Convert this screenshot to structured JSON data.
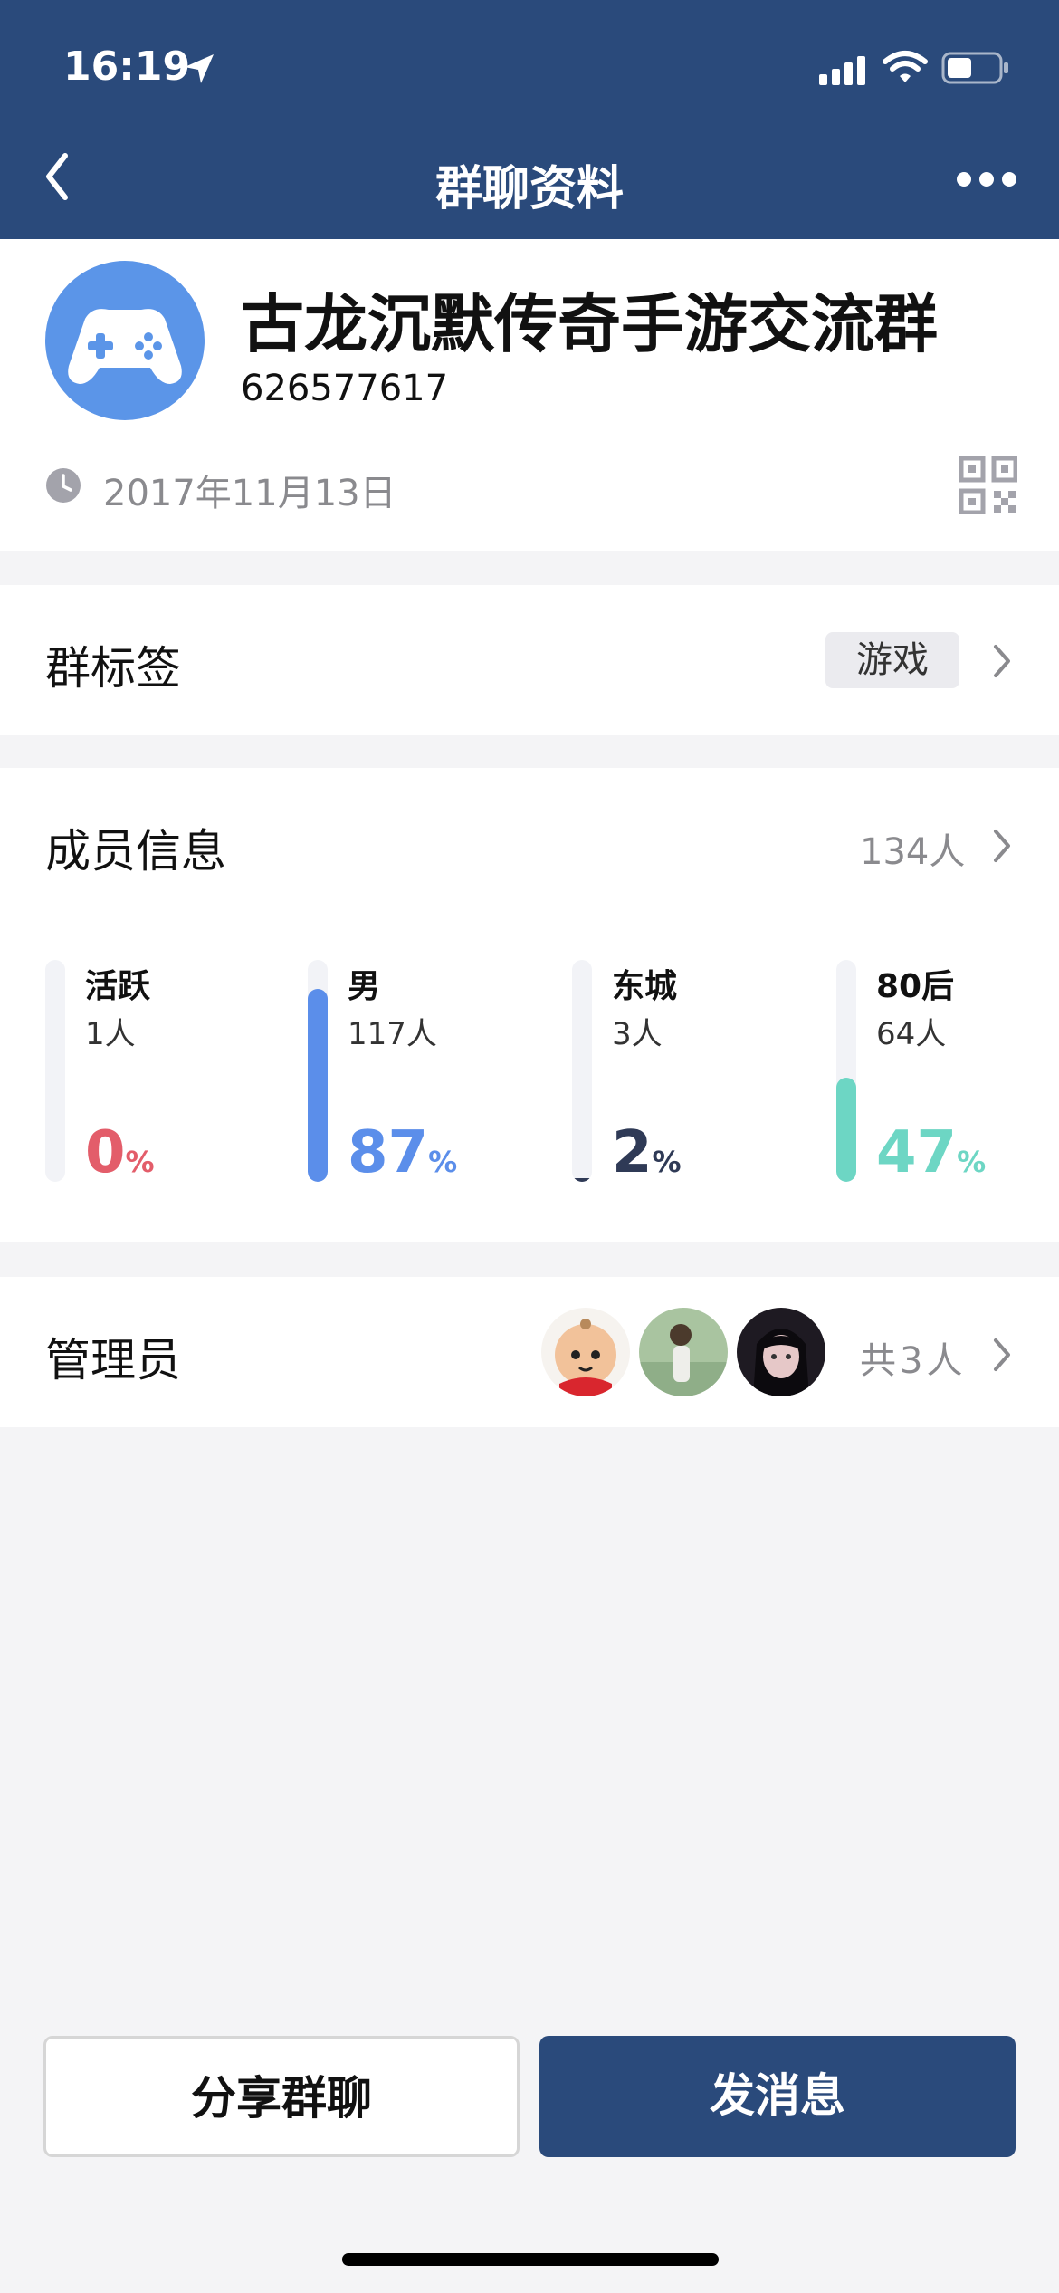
{
  "status_bar": {
    "time": "16:19"
  },
  "nav": {
    "title": "群聊资料"
  },
  "group": {
    "name": "古龙沉默传奇手游交流群",
    "id": "626577617",
    "created": "2017年11月13日",
    "avatar_icon": "gamepad-icon"
  },
  "tags": {
    "title": "群标签",
    "chip": "游戏"
  },
  "members": {
    "title": "成员信息",
    "count": "134人",
    "stats": [
      {
        "label": "活跃",
        "sub": "1人",
        "percent": 0,
        "unit": "%",
        "color": "#e35d6a"
      },
      {
        "label": "男",
        "sub": "117人",
        "percent": 87,
        "unit": "%",
        "color": "#5b8eea"
      },
      {
        "label": "东城",
        "sub": "3人",
        "percent": 2,
        "unit": "%",
        "color": "#2f3a56"
      },
      {
        "label": "80后",
        "sub": "64人",
        "percent": 47,
        "unit": "%",
        "color": "#6dd6c4"
      }
    ]
  },
  "admins": {
    "title": "管理员",
    "count": "共3人"
  },
  "buttons": {
    "share": "分享群聊",
    "send": "发消息"
  }
}
